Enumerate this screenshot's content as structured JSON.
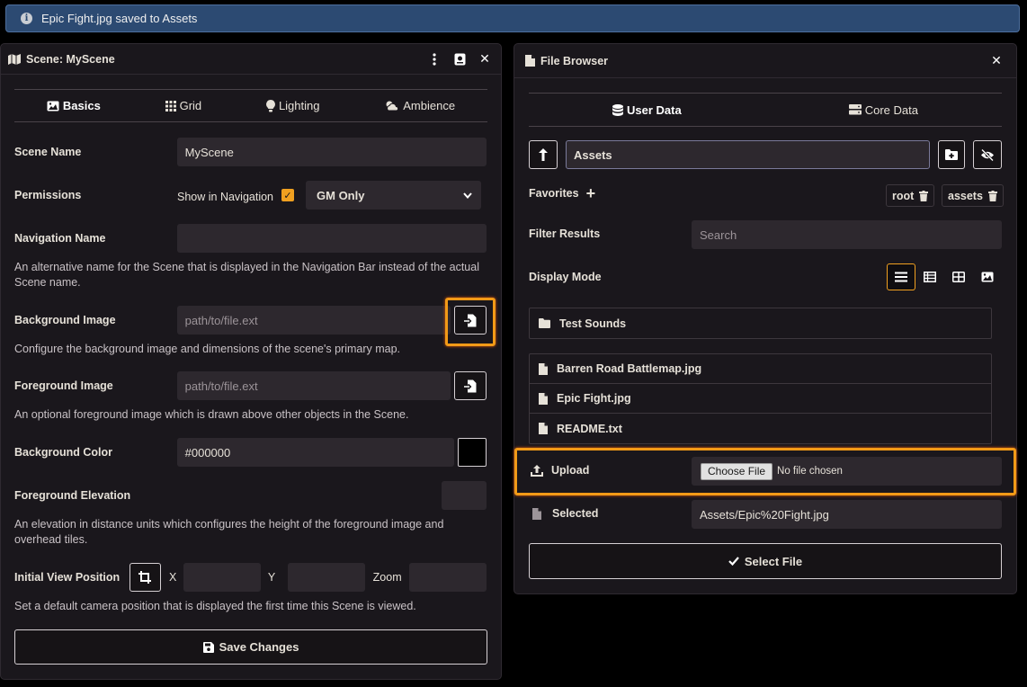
{
  "notification": {
    "text": "Epic Fight.jpg saved to Assets",
    "icon": "info-icon"
  },
  "scene": {
    "title": "Scene: MyScene",
    "tabs": [
      {
        "label": "Basics",
        "icon": "image-icon",
        "active": true
      },
      {
        "label": "Grid",
        "icon": "grid-icon"
      },
      {
        "label": "Lighting",
        "icon": "lightbulb-icon"
      },
      {
        "label": "Ambience",
        "icon": "cloud-sun-icon"
      }
    ],
    "scene_name_label": "Scene Name",
    "scene_name_value": "MyScene",
    "permissions_label": "Permissions",
    "show_in_nav_label": "Show in Navigation",
    "permission_value": "GM Only",
    "nav_name_label": "Navigation Name",
    "nav_name_value": "",
    "nav_name_hint": "An alternative name for the Scene that is displayed in the Navigation Bar instead of the actual Scene name.",
    "bg_image_label": "Background Image",
    "bg_image_placeholder": "path/to/file.ext",
    "bg_image_hint": "Configure the background image and dimensions of the scene's primary map.",
    "fg_image_label": "Foreground Image",
    "fg_image_placeholder": "path/to/file.ext",
    "fg_image_hint": "An optional foreground image which is drawn above other objects in the Scene.",
    "bg_color_label": "Background Color",
    "bg_color_value": "#000000",
    "fg_elevation_label": "Foreground Elevation",
    "fg_elevation_hint": "An elevation in distance units which configures the height of the foreground image and overhead tiles.",
    "view_position_label": "Initial View Position",
    "x_label": "X",
    "y_label": "Y",
    "zoom_label": "Zoom",
    "view_position_hint": "Set a default camera position that is displayed the first time this Scene is viewed.",
    "save_label": "Save Changes"
  },
  "browser": {
    "title": "File Browser",
    "tabs": [
      {
        "label": "User Data",
        "icon": "database-icon",
        "active": true
      },
      {
        "label": "Core Data",
        "icon": "server-icon"
      }
    ],
    "path_value": "Assets",
    "favorites_label": "Favorites",
    "favorite_pills": [
      {
        "label": "root"
      },
      {
        "label": "assets"
      }
    ],
    "filter_label": "Filter Results",
    "filter_placeholder": "Search",
    "display_mode_label": "Display Mode",
    "folders": [
      {
        "name": "Test Sounds"
      }
    ],
    "files": [
      {
        "name": "Barren Road Battlemap.jpg"
      },
      {
        "name": "Epic Fight.jpg"
      },
      {
        "name": "README.txt"
      }
    ],
    "upload_label": "Upload",
    "choose_file_label": "Choose File",
    "no_file_label": "No file chosen",
    "selected_label": "Selected",
    "selected_value": "Assets/Epic%20Fight.jpg",
    "select_button_label": "Select File"
  },
  "colors": {
    "accent": "#f0a020",
    "highlight": "#f29a17",
    "panel": "#1a171c",
    "input": "#2d282e",
    "notice": "#2c4a72"
  }
}
